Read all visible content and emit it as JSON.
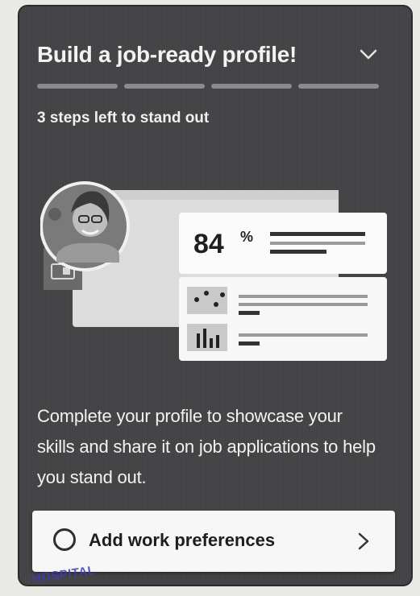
{
  "card": {
    "title": "Build a job-ready profile!",
    "subtitle": "3 steps left to stand out",
    "progress_segments": 4,
    "illustration": {
      "percent": "84",
      "percent_sign": "%"
    },
    "description": "Complete your profile to showcase your skills and share it on job applications to help you stand out.",
    "action": {
      "label": "Add work preferences",
      "icon_left": "radio-circle-icon",
      "icon_right": "chevron-right-icon"
    }
  },
  "stamp_text": "HOSPITAL"
}
